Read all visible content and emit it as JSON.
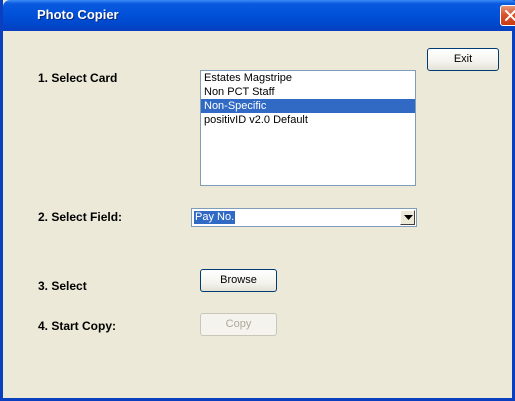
{
  "window": {
    "title": "Photo Copier"
  },
  "toolbar": {
    "exit_label": "Exit"
  },
  "steps": {
    "select_card_label": "1. Select Card",
    "select_field_label": "2. Select Field:",
    "select_label": "3. Select",
    "start_copy_label": "4. Start Copy:"
  },
  "card_list": {
    "items": [
      {
        "label": "Estates Magstripe",
        "selected": false
      },
      {
        "label": "Non PCT Staff",
        "selected": false
      },
      {
        "label": "Non-Specific",
        "selected": true
      },
      {
        "label": "positivID v2.0 Default",
        "selected": false
      }
    ]
  },
  "field_select": {
    "value": "Pay No."
  },
  "buttons": {
    "browse_label": "Browse",
    "copy_label": "Copy",
    "copy_enabled": false
  },
  "colors": {
    "titlebar": "#0050d8",
    "selection": "#316ac5",
    "window_bg": "#ece9d8",
    "close_button": "#d9542c"
  },
  "icons": {
    "close": "close-icon",
    "dropdown": "chevron-down-icon"
  }
}
